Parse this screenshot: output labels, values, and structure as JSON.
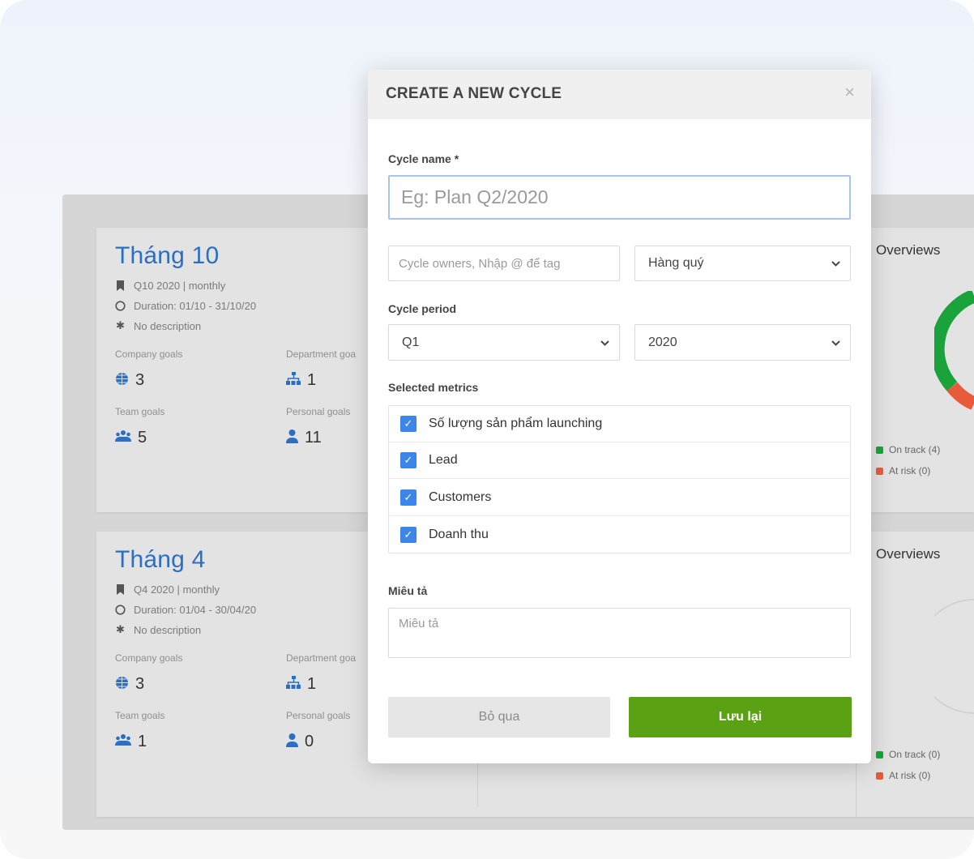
{
  "cards": [
    {
      "title": "Tháng 10",
      "code": "Q10 2020 | monthly",
      "duration": "Duration: 01/10 - 31/10/20",
      "description": "No description",
      "company_label": "Company goals",
      "company_value": "3",
      "department_label": "Department goa",
      "department_value": "1",
      "team_label": "Team goals",
      "team_value": "5",
      "personal_label": "Personal goals",
      "personal_value": "11",
      "overview_title": "Overviews",
      "on_track": "On track (4)",
      "at_risk": "At risk (0)"
    },
    {
      "title": "Tháng 4",
      "code": "Q4 2020 | monthly",
      "duration": "Duration: 01/04 - 30/04/20",
      "description": "No description",
      "company_label": "Company goals",
      "company_value": "3",
      "department_label": "Department goa",
      "department_value": "1",
      "team_label": "Team goals",
      "team_value": "1",
      "personal_label": "Personal goals",
      "personal_value": "0",
      "overview_title": "Overviews",
      "on_track": "On track (0)",
      "at_risk": "At risk (0)"
    }
  ],
  "modal": {
    "title": "CREATE A NEW CYCLE",
    "close_glyph": "×",
    "cycle_name_label": "Cycle name *",
    "cycle_name_placeholder": "Eg: Plan Q2/2020",
    "owners_placeholder": "Cycle owners, Nhập @ để tag",
    "frequency_value": "Hàng quý",
    "cycle_period_label": "Cycle period",
    "period_quarter": "Q1",
    "period_year": "2020",
    "metrics_label": "Selected metrics",
    "metrics": [
      "Số lượng sản phẩm launching",
      "Lead",
      "Customers",
      "Doanh thu"
    ],
    "description_label": "Miêu tả",
    "description_placeholder": "Miêu tả",
    "cancel_label": "Bỏ qua",
    "save_label": "Lưu lại"
  },
  "colors": {
    "accent": "#2b6fc2",
    "checkbox": "#3b86e8",
    "save": "#5aa114",
    "on_track": "#1aa33a",
    "at_risk": "#e85b3a"
  }
}
